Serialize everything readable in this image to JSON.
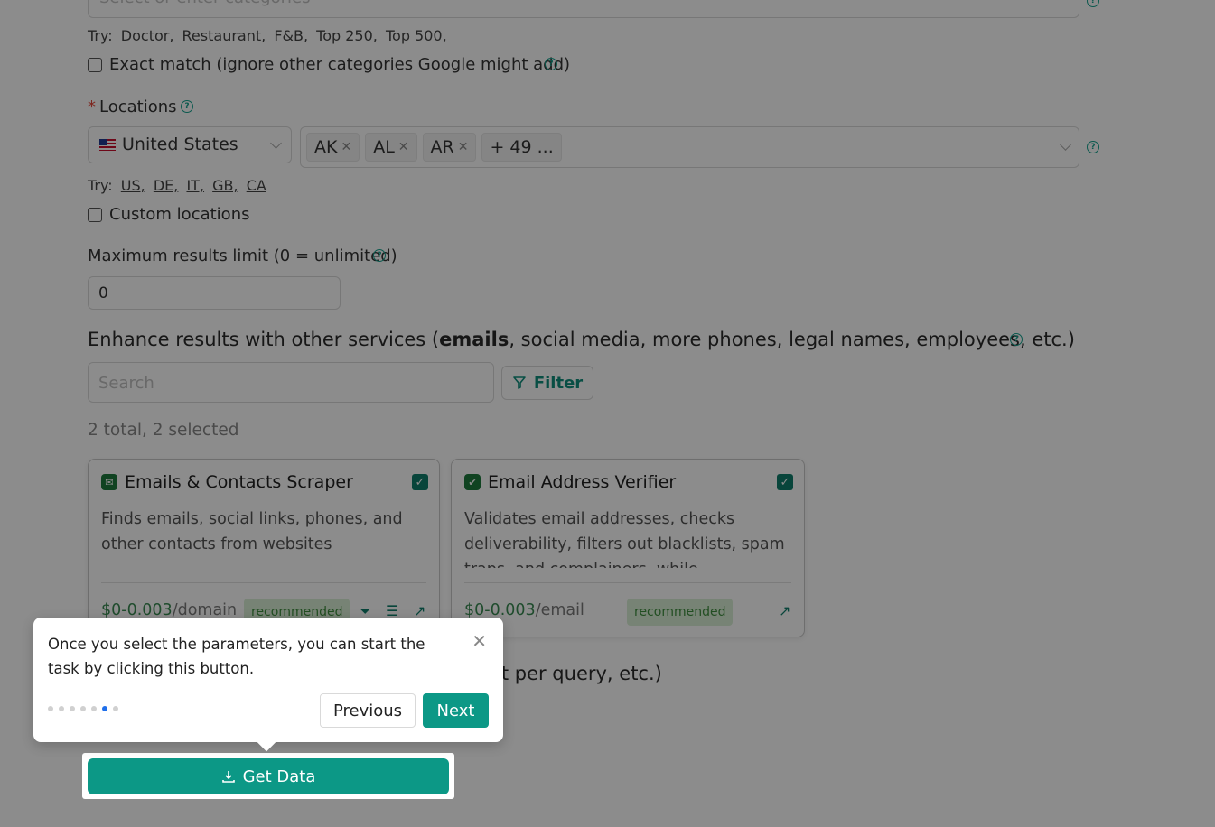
{
  "categories": {
    "placeholder": "Select or enter categories",
    "try_label": "Try:",
    "try_links": [
      "Doctor,",
      "Restaurant,",
      "F&B,",
      "Top 250,",
      "Top 500,"
    ],
    "exact_match_label": "Exact match (ignore other categories Google might add)"
  },
  "locations": {
    "label": "Locations",
    "country": "United States",
    "tags": [
      "AK",
      "AL",
      "AR"
    ],
    "more": "+ 49 ...",
    "try_label": "Try:",
    "try_links": [
      "US,",
      "DE,",
      "IT,",
      "GB,",
      "CA"
    ],
    "custom_label": "Custom locations"
  },
  "limit": {
    "label": "Maximum results limit (0 = unlimited)",
    "value": "0"
  },
  "enhance": {
    "title_pre": "Enhance results with other services (",
    "title_bold": "emails",
    "title_post": ", social media, more phones, legal names, employees, etc.)",
    "search_placeholder": "Search",
    "filter_label": "Filter",
    "summary": "2 total, 2 selected"
  },
  "cards": [
    {
      "title": "Emails & Contacts Scraper",
      "description": "Finds emails, social links, phones, and other contacts from websites",
      "price_accent": "$0-0.003",
      "price_unit": "/domain",
      "badge": "recommended"
    },
    {
      "title": "Email Address Verifier",
      "description": "Validates email addresses, checks deliverability, filters out blacklists, spam traps, and complainers, while significantly",
      "price_accent": "$0-0.003",
      "price_unit": "/email",
      "badge": "recommended"
    }
  ],
  "hidden_section_text": "it per query, etc.)",
  "tooltip": {
    "text": "Once you select the parameters, you can start the task by clicking this button.",
    "previous": "Previous",
    "next": "Next",
    "step_total": 7,
    "step_current": 6
  },
  "get_data_label": "Get Data",
  "colors": {
    "accent": "#0c9886",
    "help": "#15a38f",
    "required": "#e5483b"
  }
}
